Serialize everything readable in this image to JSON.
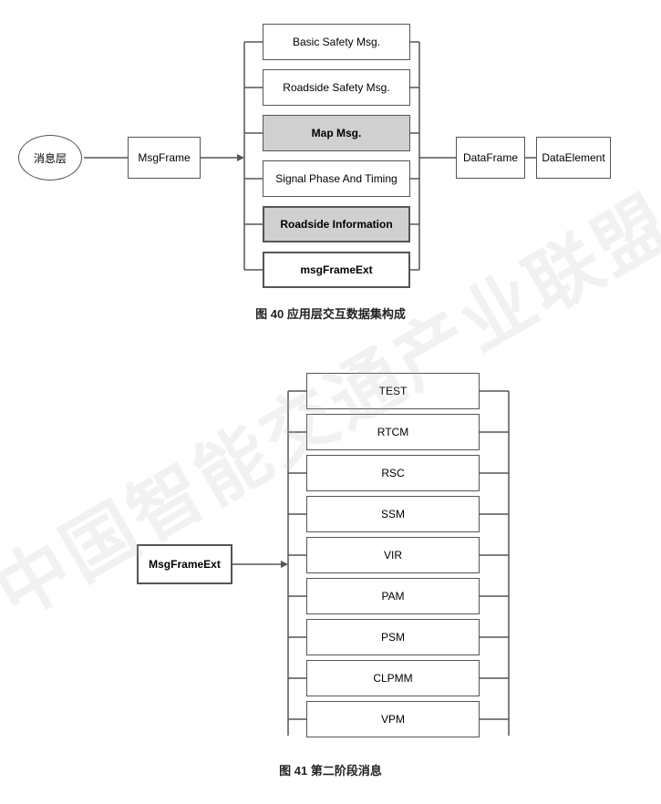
{
  "fig40": {
    "caption": "图 40  应用层交互数据集构成",
    "nodes": {
      "message_layer": "消息层",
      "msg_frame": "MsgFrame",
      "basic_safety": "Basic Safety Msg.",
      "roadside_safety": "Roadside Safety Msg.",
      "map_msg": "Map Msg.",
      "signal_phase": "Signal Phase And Timing",
      "roadside_info": "Roadside Information",
      "msg_frame_ext": "msgFrameExt",
      "data_frame": "DataFrame",
      "data_element": "DataElement"
    }
  },
  "fig41": {
    "caption": "图 41  第二阶段消息",
    "nodes": {
      "msg_frame_ext": "MsgFrameExt",
      "items": [
        "TEST",
        "RTCM",
        "RSC",
        "SSM",
        "VIR",
        "PAM",
        "PSM",
        "CLPMM",
        "VPM"
      ]
    }
  },
  "watermark": "中国智能交通产业联盟"
}
